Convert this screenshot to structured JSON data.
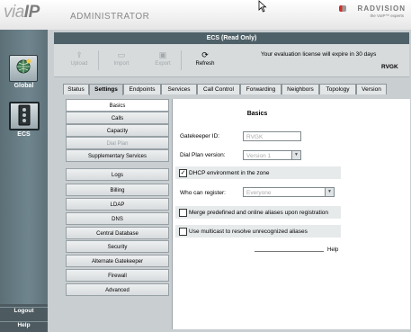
{
  "header": {
    "logo_light": "via",
    "logo_bold": "IP",
    "subtitle": "ADMINISTRATOR",
    "brand": "RADVISION",
    "brand_tagline": "the VoIP™ experts"
  },
  "left_nav": {
    "items": [
      {
        "label": "Global",
        "icon": "globe-icon"
      },
      {
        "label": "ECS",
        "icon": "server-icon"
      }
    ],
    "logout": "Logout",
    "help": "Help"
  },
  "window": {
    "title": "ECS (Read Only)"
  },
  "toolbar": {
    "upload": "Upload",
    "import": "Import",
    "export": "Export",
    "refresh": "Refresh",
    "license": "Your evaluation license will expire in 30 days",
    "gatekeeper": "RVGK"
  },
  "tabs": [
    "Status",
    "Settings",
    "Endpoints",
    "Services",
    "Call Control",
    "Forwarding",
    "Neighbors",
    "Topology",
    "Version"
  ],
  "active_tab": "Settings",
  "menu": [
    "Basics",
    "Calls",
    "Capacity",
    "Dial Plan",
    "Supplementary Services",
    "Logs",
    "Billing",
    "LDAP",
    "DNS",
    "Central Database",
    "Security",
    "Alternate Gatekeeper",
    "Firewall",
    "Advanced"
  ],
  "active_menu": "Basics",
  "basics": {
    "title": "Basics",
    "gatekeeper_id_label": "Gatekeeper ID:",
    "gatekeeper_id_value": "RVGK",
    "dial_plan_label": "Dial Plan version:",
    "dial_plan_value": "Version 1",
    "dhcp_label": "DHCP environment in the zone",
    "dhcp_checked": true,
    "who_register_label": "Who can register:",
    "who_register_value": "Everyone",
    "merge_label": "Merge predefined and online aliases upon registration",
    "merge_checked": false,
    "multicast_label": "Use multicast to resolve unrecognized aliases",
    "multicast_checked": false,
    "help": "Help"
  },
  "colors": {
    "title_bar": "#4f6168",
    "left_nav": "#6f858e",
    "panel": "#c9ced1"
  }
}
